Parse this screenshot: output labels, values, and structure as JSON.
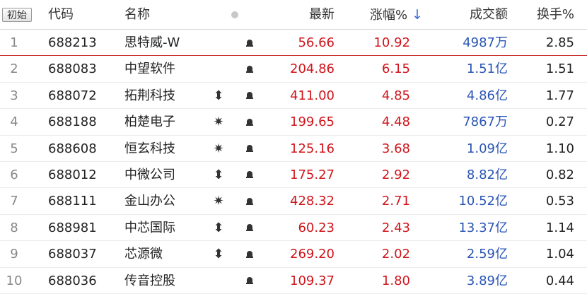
{
  "header": {
    "reset_label": "初始",
    "code": "代码",
    "name": "名称",
    "price": "最新",
    "change": "涨幅%",
    "sort_arrow": "↓",
    "volume": "成交额",
    "turnover": "换手%"
  },
  "colors": {
    "up": "#d0151b",
    "volume": "#2a55b5",
    "sort": "#3a6fd8"
  },
  "rows": [
    {
      "no": "1",
      "code": "688213",
      "name": "思特威-W",
      "icon": "",
      "price": "56.66",
      "change": "10.92",
      "volume": "4987万",
      "turnover": "2.85"
    },
    {
      "no": "2",
      "code": "688083",
      "name": "中望软件",
      "icon": "",
      "price": "204.86",
      "change": "6.15",
      "volume": "1.51亿",
      "turnover": "1.51"
    },
    {
      "no": "3",
      "code": "688072",
      "name": "拓荆科技",
      "icon": "⬍",
      "price": "411.00",
      "change": "4.85",
      "volume": "4.86亿",
      "turnover": "1.77"
    },
    {
      "no": "4",
      "code": "688188",
      "name": "柏楚电子",
      "icon": "✷",
      "price": "199.65",
      "change": "4.48",
      "volume": "7867万",
      "turnover": "0.27"
    },
    {
      "no": "5",
      "code": "688608",
      "name": "恒玄科技",
      "icon": "✷",
      "price": "125.16",
      "change": "3.68",
      "volume": "1.09亿",
      "turnover": "1.10"
    },
    {
      "no": "6",
      "code": "688012",
      "name": "中微公司",
      "icon": "⬍",
      "price": "175.27",
      "change": "2.92",
      "volume": "8.82亿",
      "turnover": "0.82"
    },
    {
      "no": "7",
      "code": "688111",
      "name": "金山办公",
      "icon": "✷",
      "price": "428.32",
      "change": "2.71",
      "volume": "10.52亿",
      "turnover": "0.53"
    },
    {
      "no": "8",
      "code": "688981",
      "name": "中芯国际",
      "icon": "⬍",
      "price": "60.23",
      "change": "2.43",
      "volume": "13.37亿",
      "turnover": "1.14"
    },
    {
      "no": "9",
      "code": "688037",
      "name": "芯源微",
      "icon": "⬍",
      "price": "269.20",
      "change": "2.02",
      "volume": "2.59亿",
      "turnover": "1.04"
    },
    {
      "no": "10",
      "code": "688036",
      "name": "传音控股",
      "icon": "",
      "price": "109.37",
      "change": "1.80",
      "volume": "3.89亿",
      "turnover": "0.44"
    }
  ]
}
